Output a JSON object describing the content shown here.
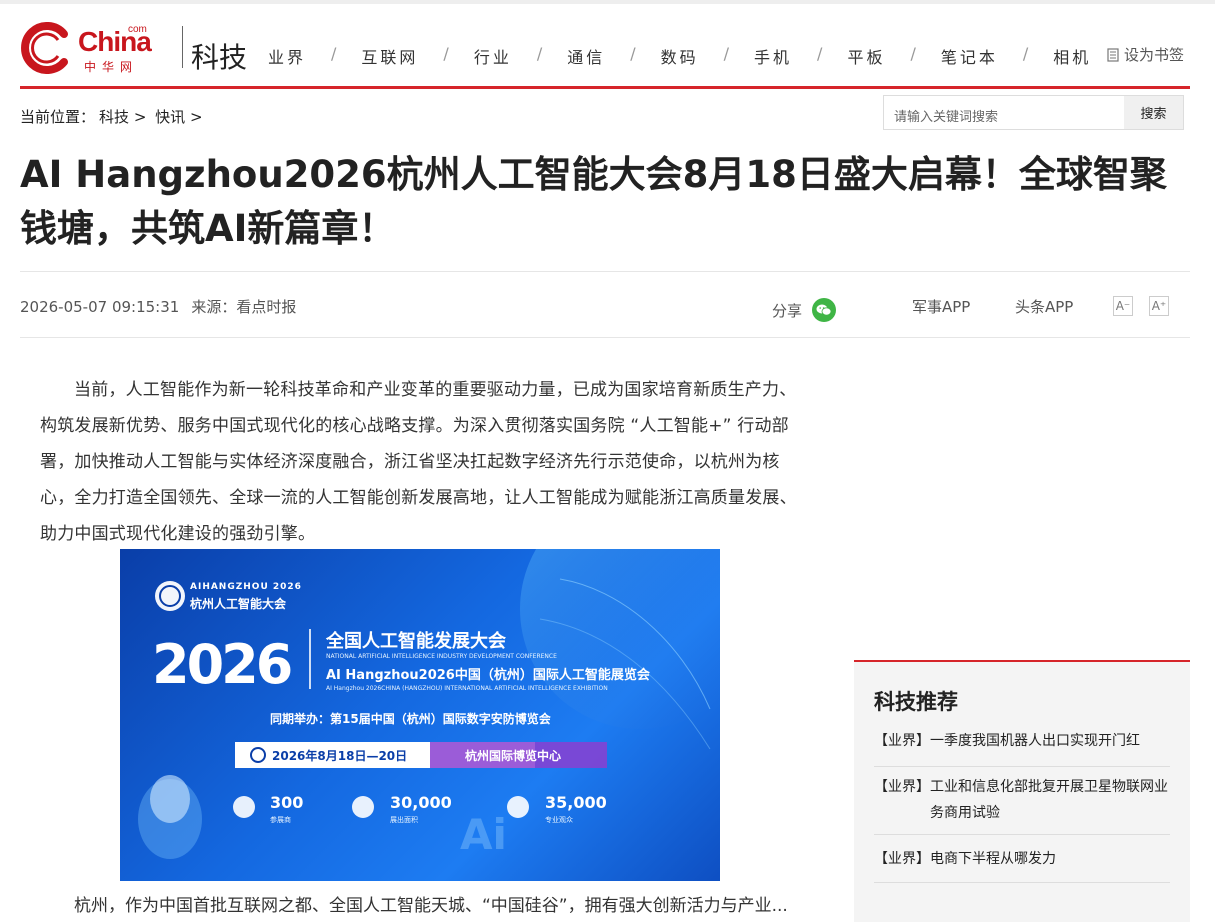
{
  "header": {
    "logo_text": "China",
    "logo_com": "com",
    "logo_cn": "中华网",
    "channel": "科技",
    "nav": [
      "业界",
      "互联网",
      "行业",
      "通信",
      "数码",
      "手机",
      "平板",
      "笔记本",
      "相机"
    ],
    "bookmark": "设为书签"
  },
  "breadcrumb": {
    "prefix": "当前位置：",
    "items": [
      "科技",
      "快讯"
    ],
    "sep": ">"
  },
  "search": {
    "placeholder": "请输入关键词搜索",
    "button": "搜索"
  },
  "article": {
    "title": "AI Hangzhou2026杭州人工智能大会8月18日盛大启幕！全球智聚钱塘，共筑AI新篇章！",
    "datetime": "2026-05-07 09:15:31",
    "source": "来源：看点时报",
    "share": "分享",
    "app1": "军事APP",
    "app2": "头条APP",
    "font_minus": "A⁻",
    "font_plus": "A⁺",
    "paragraph1": "当前，人工智能作为新一轮科技革命和产业变革的重要驱动力量，已成为国家培育新质生产力、构筑发展新优势、服务中国式现代化的核心战略支撑。为深入贯彻落实国务院 “人工智能+” 行动部署，加快推动人工智能与实体经济深度融合，浙江省坚决扛起数字经济先行示范使命，以杭州为核心，全力打造全国领先、全球一流的人工智能创新发展高地，让人工智能成为赋能浙江高质量发展、助力中国式现代化建设的强劲引擎。",
    "paragraph2": "杭州，作为中国首批互联网之都、全国人工智能天城、“中国硅谷”，拥有强大创新活力与产业..."
  },
  "banner": {
    "brand_en": "AIHANGZHOU 2026",
    "brand_cn": "杭州人工智能大会",
    "year": "2026",
    "conf_cn": "全国人工智能发展大会",
    "conf_en": "NATIONAL ARTIFICIAL INTELLIGENCE INDUSTRY DEVELOPMENT CONFERENCE",
    "expo_cn": "AI Hangzhou2026中国（杭州）国际人工智能展览会",
    "expo_en": "AI Hangzhou 2026CHINA (HANGZHOU) INTERNATIONAL ARTIFICIAL INTELLIGENCE EXHIBITION",
    "concurrent": "同期举办：第15届中国（杭州）国际数字安防博览会",
    "date": "2026年8月18日—20日",
    "venue": "杭州国际博览中心",
    "stats": [
      {
        "value": "300",
        "label": "参展商"
      },
      {
        "value": "30,000",
        "label": "展出面积"
      },
      {
        "value": "35,000",
        "label": "专业观众"
      }
    ],
    "colors": {
      "bg": "#1468e0",
      "accent": "#ffffff",
      "dark": "#0a3ea8"
    }
  },
  "sidebar": {
    "title": "科技推荐",
    "items": [
      {
        "tag": "【业界】",
        "text": "一季度我国机器人出口实现开门红"
      },
      {
        "tag": "【业界】",
        "text": "工业和信息化部批复开展卫星物联网业务商用试验"
      },
      {
        "tag": "【业界】",
        "text": "电商下半程从哪发力"
      }
    ]
  },
  "colors": {
    "brand_red": "#d6252a",
    "wechat_green": "#3fb545"
  }
}
